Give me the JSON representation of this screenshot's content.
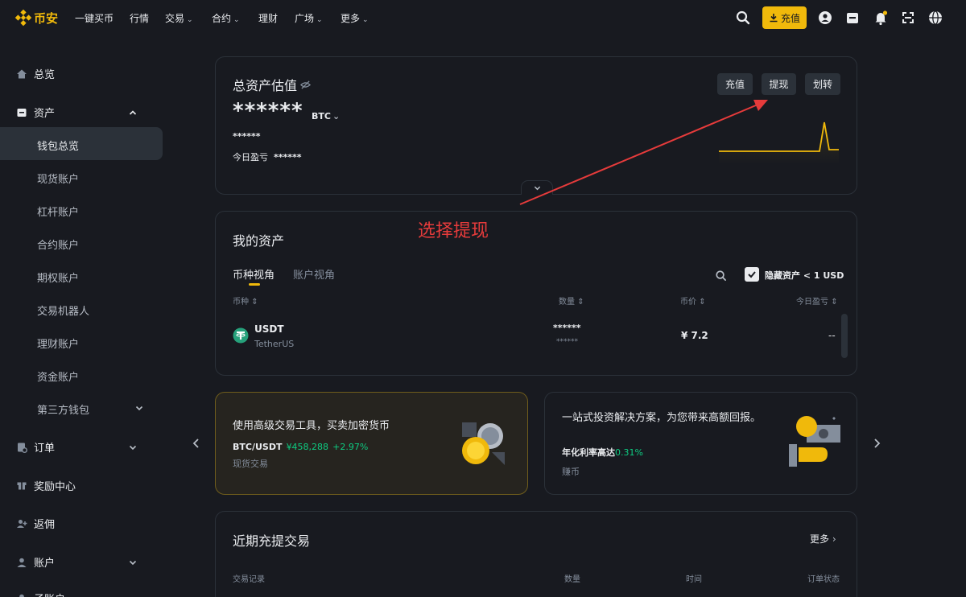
{
  "header": {
    "brand": "币安",
    "nav": [
      {
        "label": "一键买币",
        "dropdown": false
      },
      {
        "label": "行情",
        "dropdown": false
      },
      {
        "label": "交易",
        "dropdown": true
      },
      {
        "label": "合约",
        "dropdown": true
      },
      {
        "label": "理财",
        "dropdown": false
      },
      {
        "label": "广场",
        "dropdown": true
      },
      {
        "label": "更多",
        "dropdown": true
      }
    ],
    "deposit_label": "充值",
    "icons": [
      "search-icon",
      "download-icon",
      "user-icon",
      "wallet-icon",
      "bell-icon",
      "qr-icon",
      "globe-icon"
    ],
    "accent": "#f0b90b"
  },
  "sidebar": {
    "overview": "总览",
    "assets": "资产",
    "asset_items": [
      "钱包总览",
      "现货账户",
      "杠杆账户",
      "合约账户",
      "期权账户",
      "交易机器人",
      "理财账户",
      "资金账户",
      "第三方钱包"
    ],
    "orders": "订单",
    "rewards": "奖励中心",
    "rebate": "返佣",
    "account": "账户",
    "subaccount": "子账户"
  },
  "balance": {
    "title": "总资产估值",
    "hidden_value": "******",
    "unit": "BTC",
    "fiat_hidden": "******",
    "pnl_label": "今日盈亏",
    "pnl_hidden": "******",
    "buttons": [
      "充值",
      "提现",
      "划转"
    ]
  },
  "annotation": {
    "text": "选择提现",
    "color": "#e63b3b"
  },
  "my_assets": {
    "title": "我的资产",
    "tabs": [
      "币种视角",
      "账户视角"
    ],
    "hide_small_label": "隐藏资产 < 1 USD",
    "hide_small_checked": true,
    "columns": [
      "币种",
      "数量",
      "币价",
      "今日盈亏"
    ],
    "rows": [
      {
        "symbol": "USDT",
        "name": "TetherUS",
        "qty": "******",
        "qty_sub": "******",
        "price": "¥ 7.2",
        "pnl": "--"
      }
    ]
  },
  "promos": [
    {
      "title": "使用高级交易工具，买卖加密货币",
      "pair": "BTC/USDT",
      "price": "¥458,288",
      "change": "+2.97%",
      "tag": "现货交易"
    },
    {
      "title": "一站式投资解决方案，为您带来高额回报。",
      "rate_label": "年化利率高达",
      "rate": "0.31%",
      "tag": "赚币"
    }
  ],
  "recent": {
    "title": "近期充提交易",
    "more": "更多",
    "columns": [
      "交易记录",
      "数量",
      "时间",
      "订单状态"
    ]
  }
}
